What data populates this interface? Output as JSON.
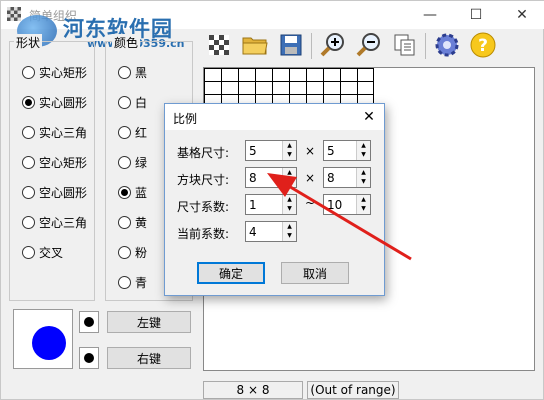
{
  "window": {
    "title": "简单组织",
    "watermark": "河东软件园",
    "watermark_url": "www.pc0359.cn"
  },
  "toolbar": {
    "icons": [
      "grid-icon",
      "open-folder-icon",
      "save-icon",
      "zoom-in-icon",
      "zoom-out-icon",
      "copy-icon",
      "settings-gear-icon",
      "help-icon"
    ]
  },
  "shape_panel": {
    "title": "形状",
    "options": [
      "实心矩形",
      "实心圆形",
      "实心三角",
      "空心矩形",
      "空心圆形",
      "空心三角",
      "交叉"
    ],
    "selected": "实心圆形"
  },
  "color_panel": {
    "title": "颜色",
    "options": [
      "黑",
      "白",
      "红",
      "绿",
      "蓝",
      "黄",
      "粉",
      "青"
    ],
    "selected": "蓝"
  },
  "mouse_buttons": {
    "left_label": "左键",
    "right_label": "右键"
  },
  "statusbar": {
    "size": "8 × 8",
    "position": "(Out of range)"
  },
  "dialog": {
    "title": "比例",
    "close": "✕",
    "base_grid_label": "基格尺寸:",
    "base_grid_w": "5",
    "base_grid_h": "5",
    "block_label": "方块尺寸:",
    "block_w": "8",
    "block_h": "8",
    "factor_label": "尺寸系数:",
    "factor_min": "1",
    "factor_max": "10",
    "current_label": "当前系数:",
    "current_value": "4",
    "times": "×",
    "tilde": "~",
    "ok_label": "确定",
    "cancel_label": "取消"
  },
  "colors": {
    "accent": "#0078d7",
    "preview_shape": "#0000ff",
    "annotation_arrow": "#e0201b"
  }
}
